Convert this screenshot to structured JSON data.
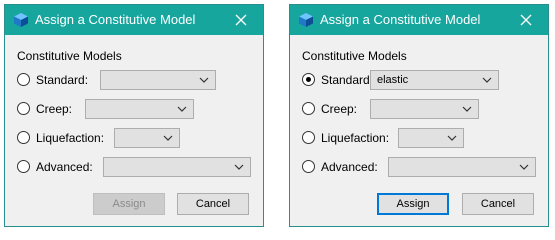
{
  "dialogs": [
    {
      "title": "Assign a Constitutive Model",
      "group_label": "Constitutive Models",
      "options": [
        {
          "label": "Standard:",
          "value": "",
          "checked": false
        },
        {
          "label": "Creep:",
          "value": "",
          "checked": false
        },
        {
          "label": "Liquefaction:",
          "value": "",
          "checked": false
        },
        {
          "label": "Advanced:",
          "value": "",
          "checked": false
        }
      ],
      "assign_label": "Assign",
      "assign_enabled": false,
      "cancel_label": "Cancel"
    },
    {
      "title": "Assign a Constitutive Model",
      "group_label": "Constitutive Models",
      "options": [
        {
          "label": "Standard:",
          "value": "elastic",
          "checked": true
        },
        {
          "label": "Creep:",
          "value": "",
          "checked": false
        },
        {
          "label": "Liquefaction:",
          "value": "",
          "checked": false
        },
        {
          "label": "Advanced:",
          "value": "",
          "checked": false
        }
      ],
      "assign_label": "Assign",
      "assign_enabled": true,
      "cancel_label": "Cancel"
    }
  ],
  "colors": {
    "titlebar": "#16a69e",
    "default_button_border": "#0078d7"
  },
  "icons": {
    "app": "blue-cube-icon",
    "close": "close-icon",
    "dropdown": "chevron-down-icon"
  }
}
